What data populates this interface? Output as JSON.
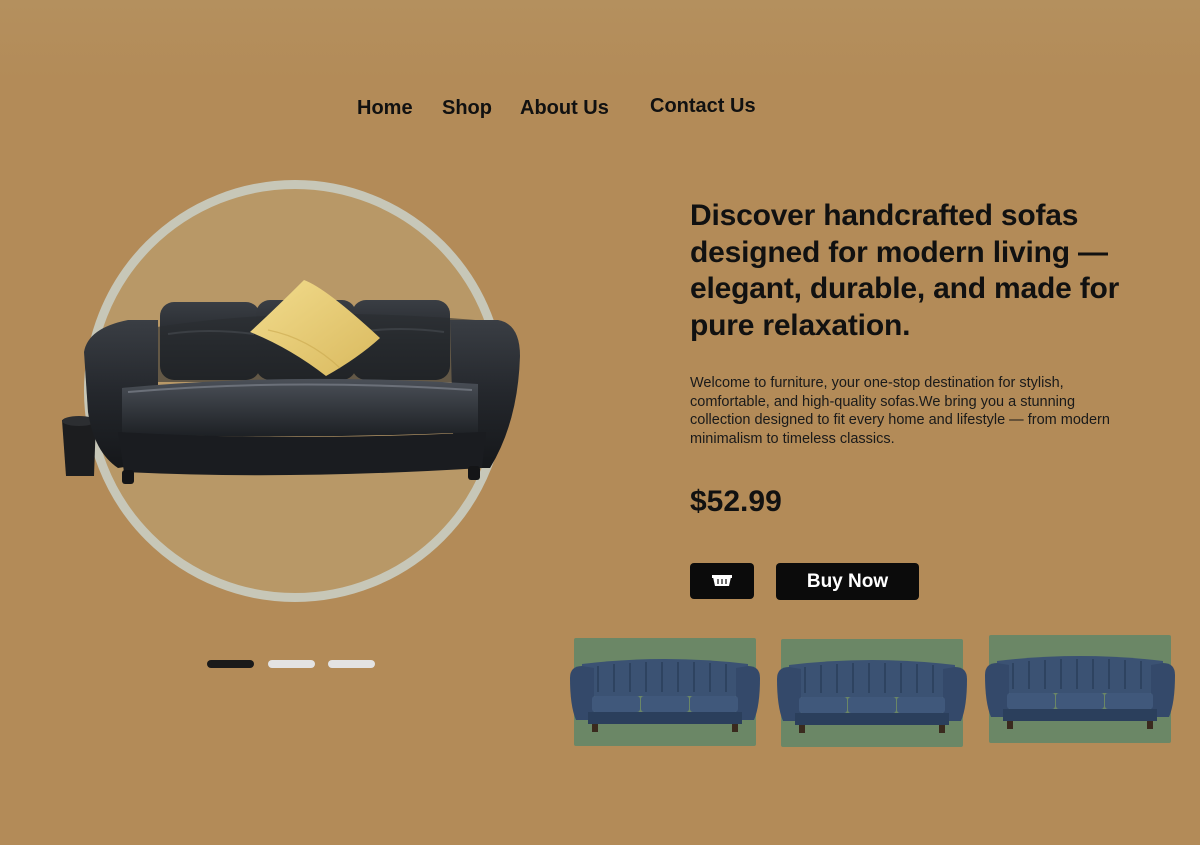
{
  "nav": {
    "items": [
      {
        "label": "Home"
      },
      {
        "label": "Shop"
      },
      {
        "label": "About Us"
      },
      {
        "label": "Contact Us"
      }
    ]
  },
  "hero": {
    "headline": "Discover handcrafted sofas designed for modern living — elegant, durable, and made for pure relaxation.",
    "description": "Welcome to  furniture, your one-stop destination for stylish, comfortable, and high-quality sofas.We bring you a stunning collection designed to fit every home and lifestyle — from modern minimalism to timeless classics.",
    "price": "$52.99",
    "cart_icon": "basket-icon",
    "buy_label": "Buy Now"
  },
  "carousel": {
    "slide_count": 3,
    "active_index": 0
  },
  "thumbnails": [
    {
      "icon": "chesterfield-sofa-thumbnail"
    },
    {
      "icon": "chesterfield-sofa-thumbnail"
    },
    {
      "icon": "chesterfield-sofa-thumbnail"
    }
  ],
  "colors": {
    "background": "#b38b58",
    "circle_ring": "#c7c7b8",
    "thumb_bg": "#6b8766",
    "button": "#0b0b0b",
    "sofa": "#2a2d31",
    "pillow": "#e9cf78",
    "chesterfield": "#2f4563"
  }
}
